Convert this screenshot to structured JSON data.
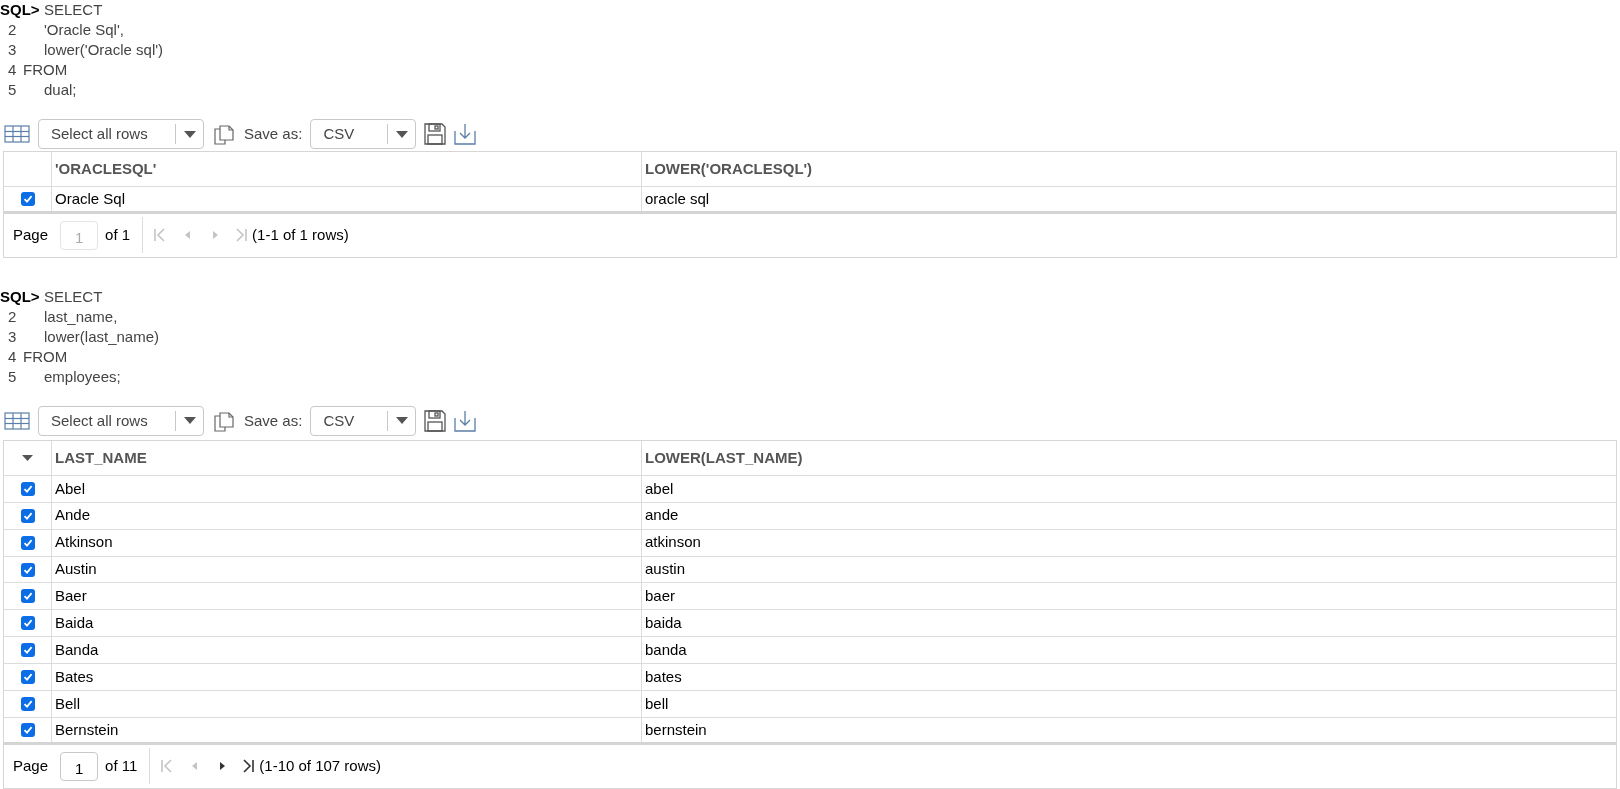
{
  "results": [
    {
      "prompt": "SQL>",
      "first_line": "SELECT",
      "lines": [
        {
          "number": "2",
          "text": "'Oracle Sql',",
          "kind": "item"
        },
        {
          "number": "3",
          "text": "lower('Oracle sql')",
          "kind": "item"
        },
        {
          "number": "4",
          "text": "FROM",
          "kind": "clause"
        },
        {
          "number": "5",
          "text": "dual;",
          "kind": "item"
        }
      ],
      "toolbar": {
        "select": "Select all rows",
        "save_label": "Save as:",
        "format": "CSV"
      },
      "table": {
        "header_menu": false,
        "columns": [
          "'ORACLESQL'",
          "LOWER('ORACLESQL')"
        ],
        "rows": [
          {
            "checked": true,
            "cells": [
              "Oracle Sql",
              "oracle sql"
            ]
          }
        ]
      },
      "pager": {
        "label": "Page",
        "value": "1",
        "input_disabled": true,
        "of": "of 1",
        "nav": [
          {
            "kind": "first",
            "disabled": true
          },
          {
            "kind": "prev",
            "disabled": true
          },
          {
            "kind": "next",
            "disabled": true
          },
          {
            "kind": "last",
            "disabled": true
          }
        ],
        "summary": "(1-1 of 1 rows)"
      }
    },
    {
      "prompt": "SQL>",
      "first_line": "SELECT",
      "lines": [
        {
          "number": "2",
          "text": "last_name,",
          "kind": "item"
        },
        {
          "number": "3",
          "text": "lower(last_name)",
          "kind": "item"
        },
        {
          "number": "4",
          "text": "FROM",
          "kind": "clause"
        },
        {
          "number": "5",
          "text": "employees;",
          "kind": "item"
        }
      ],
      "toolbar": {
        "select": "Select all rows",
        "save_label": "Save as:",
        "format": "CSV"
      },
      "table": {
        "header_menu": true,
        "columns": [
          "LAST_NAME",
          "LOWER(LAST_NAME)"
        ],
        "rows": [
          {
            "checked": true,
            "cells": [
              "Abel",
              "abel"
            ]
          },
          {
            "checked": true,
            "cells": [
              "Ande",
              "ande"
            ]
          },
          {
            "checked": true,
            "cells": [
              "Atkinson",
              "atkinson"
            ]
          },
          {
            "checked": true,
            "cells": [
              "Austin",
              "austin"
            ]
          },
          {
            "checked": true,
            "cells": [
              "Baer",
              "baer"
            ]
          },
          {
            "checked": true,
            "cells": [
              "Baida",
              "baida"
            ]
          },
          {
            "checked": true,
            "cells": [
              "Banda",
              "banda"
            ]
          },
          {
            "checked": true,
            "cells": [
              "Bates",
              "bates"
            ]
          },
          {
            "checked": true,
            "cells": [
              "Bell",
              "bell"
            ]
          },
          {
            "checked": true,
            "cells": [
              "Bernstein",
              "bernstein"
            ]
          }
        ]
      },
      "pager": {
        "label": "Page",
        "value": "1",
        "input_disabled": false,
        "of": "of 11",
        "nav": [
          {
            "kind": "first",
            "disabled": true
          },
          {
            "kind": "prev",
            "disabled": true
          },
          {
            "kind": "next",
            "disabled": false
          },
          {
            "kind": "last",
            "disabled": false
          }
        ],
        "summary": "(1-10 of 107 rows)"
      }
    }
  ]
}
